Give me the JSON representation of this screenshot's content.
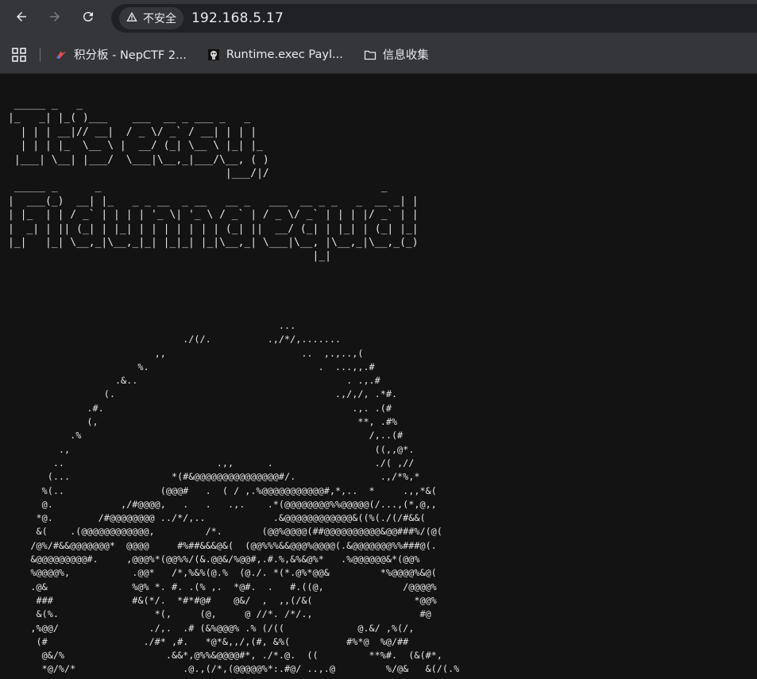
{
  "toolbar": {
    "back_icon": "arrow-left-icon",
    "forward_icon": "arrow-right-icon",
    "reload_icon": "reload-icon",
    "security_label": "不安全",
    "url": "192.168.5.17"
  },
  "bookmarks": {
    "apps_icon": "apps-grid-icon",
    "items": [
      {
        "label": "积分板 - NepCTF 2...",
        "icon": "ctf-favicon"
      },
      {
        "label": "Runtime.exec Payl...",
        "icon": "runtime-favicon"
      },
      {
        "label": "信息收集",
        "icon": "folder-icon"
      }
    ]
  },
  "page": {
    "banner_ascii": " _____ _   _\n|_   _| |_( )___    ___  __ _ ___ _   _\n  | | | __|// __|  / _ \\/ _` / __| | | |\n  | | | |_  \\__ \\ |  __/ (_| \\__ \\ |_| |_\n |___| \\__| |___/  \\___|\\__,_|___/\\__, ( )\n                                   |___/|/\n _____ _      _                                             _\n|  ___(_)  __| |_   _ _ __  _ __   __ _   ___  __ _ _   _  __ _| |\n| |_  | | / _` | | | | '_ \\| '_ \\ / _` | / _ \\/ _` | | | |/ _` | |\n|  _| | || (_| | |_| | | | | | | | (_| ||  __/ (_| | |_| | (_| |_|\n|_|   |_| \\__,_|\\__,_|_| |_|_| |_|\\__,_| \\___|\\__, |\\__,_|\\__,_(_)\n                                                 |_|",
    "art_ascii": "                                                ...\n                               ./(/.          .,/*/,.......\n                          ,,                        ..  ,.,..,(\n                       %.                              .  ...,,.#\n                   .&..                                     . .,.#\n                 (.                                       .,/,/, .*#.\n              .#.                                            .,. .(#\n              (,                                              **, .#%\n           .%                                                   /,..(#\n         .,                                                      ((,,@*.\n        ..                           .,,      .                  ./( ,//\n       (...                  *(#&@@@@@@@@@@@@@@@#/.               .,/*%,*\n      %(..                 (@@@#   .  ( / ,.%@@@@@@@@@@@#,*,..  *     .,,*&(\n      @.            ,/#@@@@,   .   .   .,.    .*(@@@@@@@@%%@@@@@(/...,(*,@,,\n     *@.        /#@@@@@@@@ ../*/,..            .&@@@@@@@@@@@@&((%(./(/#&&(\n     &(    .(@@@@@@@@@@@@,         /*.       (@@%@@@@(##@@@@@@@@@@&@@###%/(@(\n    /@%/#&&@@@@@@@*  @@@@     #%##&&&@&(  (@@%%%&&@@@%@@@@(.&@@@@@@@%%###@(.\n    &@@@@@@@@@#.     ,@@@%*(@@%%/(&.@@&/%@@#,.#.%,&%&@%*   .%@@@@@@&*(@@%\n    %@@@@%,           .@@*   /*,%&%(@.%  (@./. *(*.@%*@@&         *%@@@@%&@(\n    .@&               %@% *. #. .(% ,.  *@#.  .   #.((@,              /@@@@%\n     ###              #&(*/.  *#*#@#    @&/  ,  ,,(/&(                  *@@%\n     &(%.                 *(,     (@,     @ //*. /*/.,                   #@\n    ,%@@/                ./,.  .# (&%@@@% .% (/((             @.&/ ,%(/,\n     (#                 ./#* ,#.   *@*&,,/,(#, &%(          #%*@  %@/##\n      @&/%                  .&&*,@%%&@@@@#*, ./*.@.  ((         **%#.  (&(#*,\n      *@/%/*                   .@.,(/*,(@@@@@%*:.#@/ ..,.@         %/@&   &(/(.%"
  }
}
